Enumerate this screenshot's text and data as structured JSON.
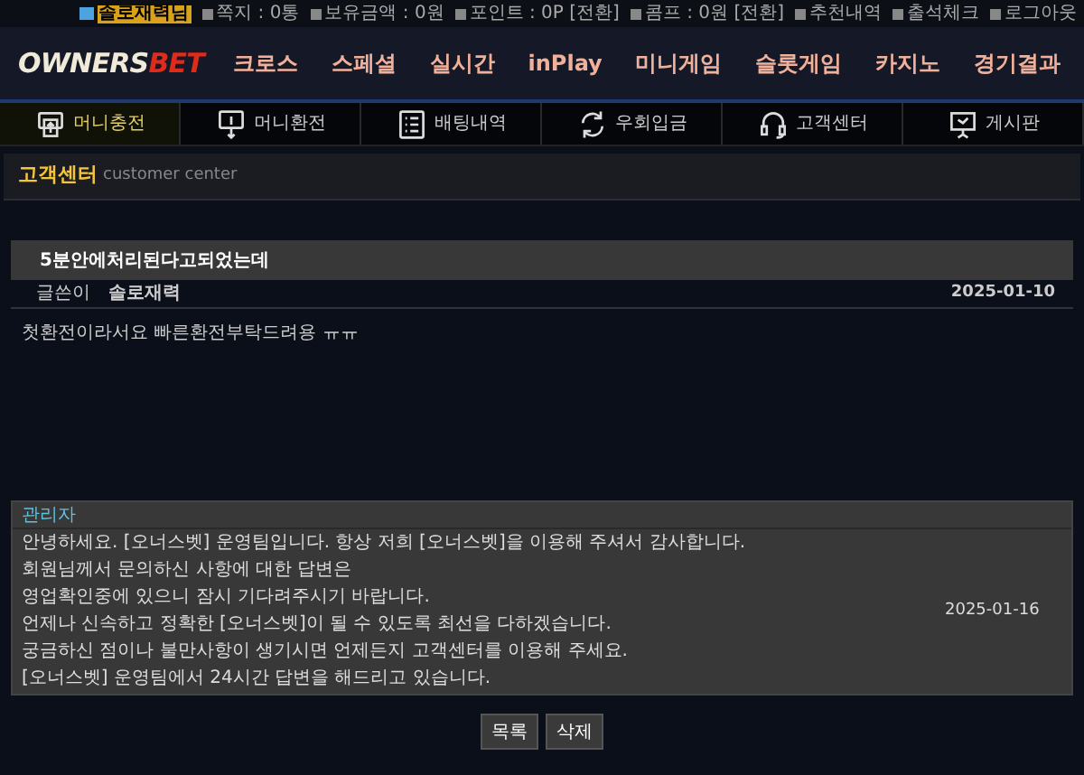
{
  "top_bar": [
    {
      "kind": "user",
      "text": "솔로재력님"
    },
    {
      "kind": "item",
      "text": "쪽지 : 0통"
    },
    {
      "kind": "item",
      "text": "보유금액 : 0원"
    },
    {
      "kind": "item",
      "text": "포인트 : 0P [전환]"
    },
    {
      "kind": "item",
      "text": "콤프 : 0원 [전환]"
    },
    {
      "kind": "item",
      "text": "추천내역"
    },
    {
      "kind": "item",
      "text": "출석체크"
    },
    {
      "kind": "item",
      "text": "로그아웃"
    }
  ],
  "logo": {
    "first": "OWNERS",
    "second": "BET"
  },
  "main_nav": [
    "크로스",
    "스페셜",
    "실시간",
    "inPlay",
    "미니게임",
    "슬롯게임",
    "카지노",
    "경기결과"
  ],
  "sub_nav": [
    {
      "label": "머니충전",
      "kind": "deposit",
      "selected": true
    },
    {
      "label": "머니환전",
      "kind": "withdraw",
      "selected": false
    },
    {
      "label": "배팅내역",
      "kind": "list",
      "selected": false
    },
    {
      "label": "우회입금",
      "kind": "refresh",
      "selected": false
    },
    {
      "label": "고객센터",
      "kind": "headset",
      "selected": false
    },
    {
      "label": "게시판",
      "kind": "board",
      "selected": false
    }
  ],
  "section": {
    "title": "고객센터",
    "subtitle": "customer center"
  },
  "post": {
    "title": "5분안에처리된다고되었는데",
    "author_label": "글쓴이",
    "author": "솔로재력",
    "date": "2025-01-10",
    "body": "첫환전이라서요 빠른환전부탁드려용 ㅠㅠ"
  },
  "reply": {
    "author": "관리자",
    "date": "2025-01-16",
    "lines": [
      "안녕하세요. [오너스벳] 운영팀입니다. 항상 저희 [오너스벳]을 이용해 주셔서 감사합니다.",
      "회원님께서 문의하신 사항에 대한 답변은",
      "영업확인중에 있으니 잠시 기다려주시기 바랍니다.",
      "언제나 신속하고 정확한 [오너스벳]이 될 수 있도록 최선을 다하겠습니다.",
      "궁금하신 점이나 불만사항이 생기시면 언제든지 고객센터를 이용해 주세요.",
      "[오너스벳] 운영팀에서 24시간 답변을 해드리고 있습니다."
    ]
  },
  "buttons": [
    "목록",
    "삭제"
  ]
}
